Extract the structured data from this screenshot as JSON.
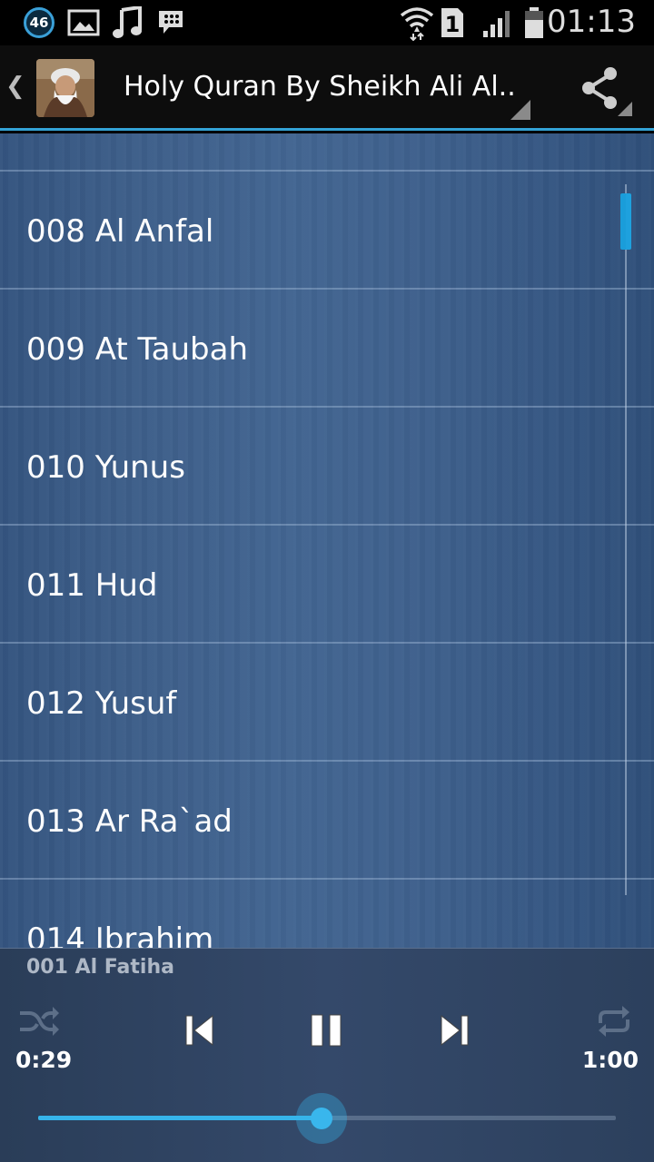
{
  "status_bar": {
    "notification_badge": "46",
    "time": "01:13",
    "sim_number": "1",
    "icons": [
      "notification-46-icon",
      "image-icon",
      "music-icon",
      "bbm-icon",
      "wifi-icon",
      "sim-1-icon",
      "signal-icon",
      "battery-icon"
    ]
  },
  "action_bar": {
    "title": "Holy Quran By Sheikh Ali Al..",
    "up_icon": "chevron-left-icon",
    "share_icon": "share-icon"
  },
  "surah_list": {
    "items": [
      {
        "label": "008 Al Anfal"
      },
      {
        "label": "009 At Taubah"
      },
      {
        "label": "010 Yunus"
      },
      {
        "label": "011 Hud"
      },
      {
        "label": "012 Yusuf"
      },
      {
        "label": "013 Ar Ra`ad"
      },
      {
        "label": "014 Ibrahim"
      }
    ]
  },
  "player": {
    "now_playing": "001 Al Fatiha",
    "elapsed": "0:29",
    "duration": "1:00",
    "progress_fraction": 0.49,
    "controls": [
      "shuffle-icon",
      "previous-icon",
      "pause-icon",
      "next-icon",
      "repeat-icon"
    ]
  },
  "colors": {
    "accent": "#33a3d6",
    "list_background": "#3e608c",
    "player_background": "#34496a"
  }
}
